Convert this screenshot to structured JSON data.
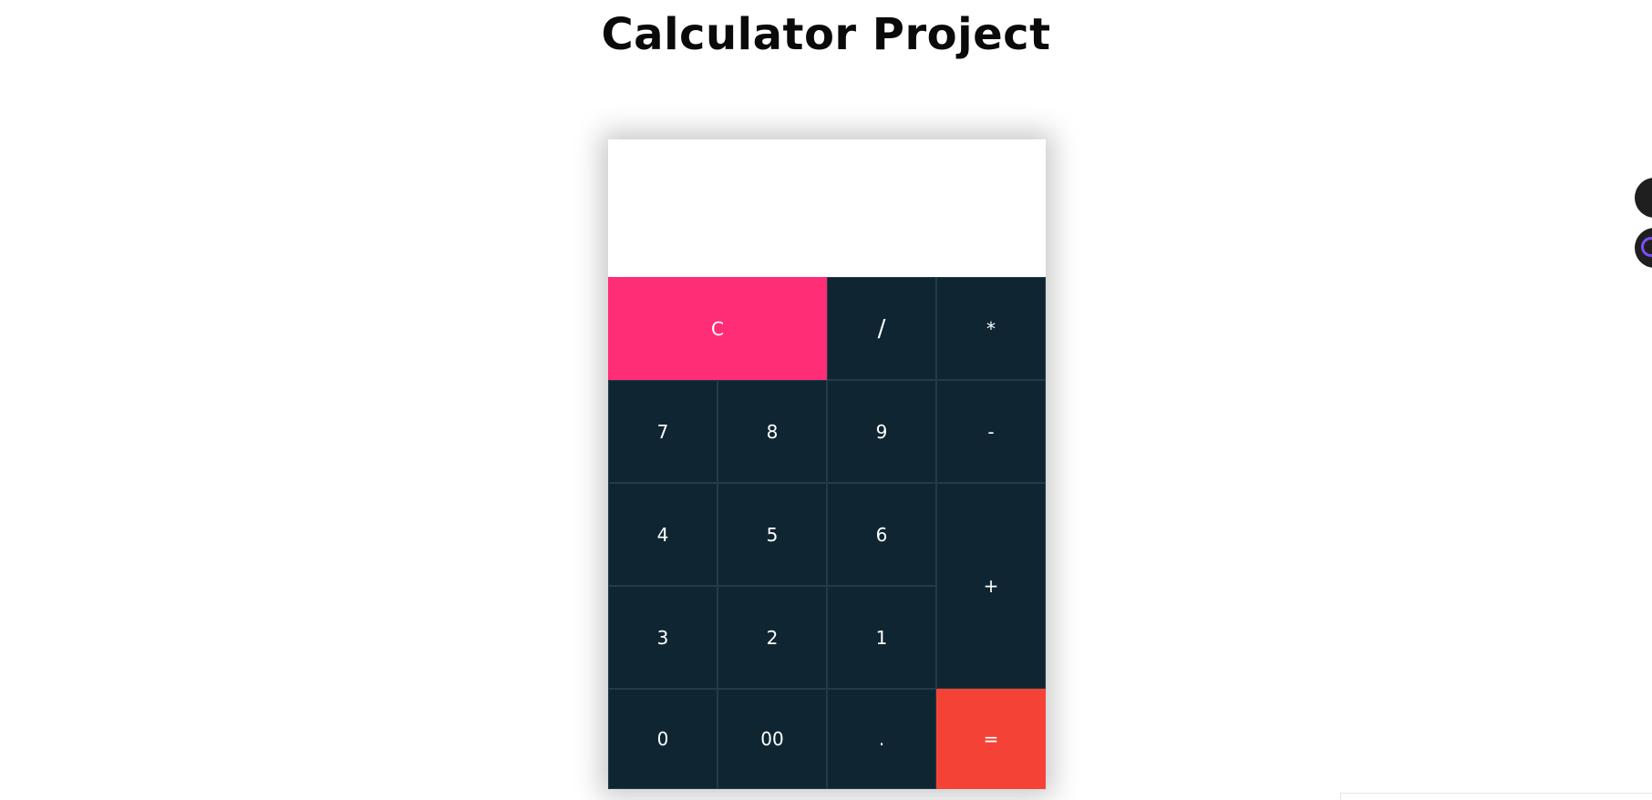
{
  "page": {
    "title": "Calculator Project"
  },
  "calculator": {
    "display_value": "",
    "keys": {
      "clear": "C",
      "divide": "/",
      "multiply": "*",
      "seven": "7",
      "eight": "8",
      "nine": "9",
      "minus": "-",
      "four": "4",
      "five": "5",
      "six": "6",
      "plus": "+",
      "three": "3",
      "two": "2",
      "one": "1",
      "zero": "0",
      "double_zero": "00",
      "decimal": ".",
      "equals": "="
    }
  },
  "colors": {
    "key_background": "#0f2632",
    "clear_key": "#ff2d76",
    "equals_key": "#f44336",
    "display_background": "#ffffff"
  },
  "floating_buttons": [
    "extension-icon",
    "assistant-icon"
  ]
}
